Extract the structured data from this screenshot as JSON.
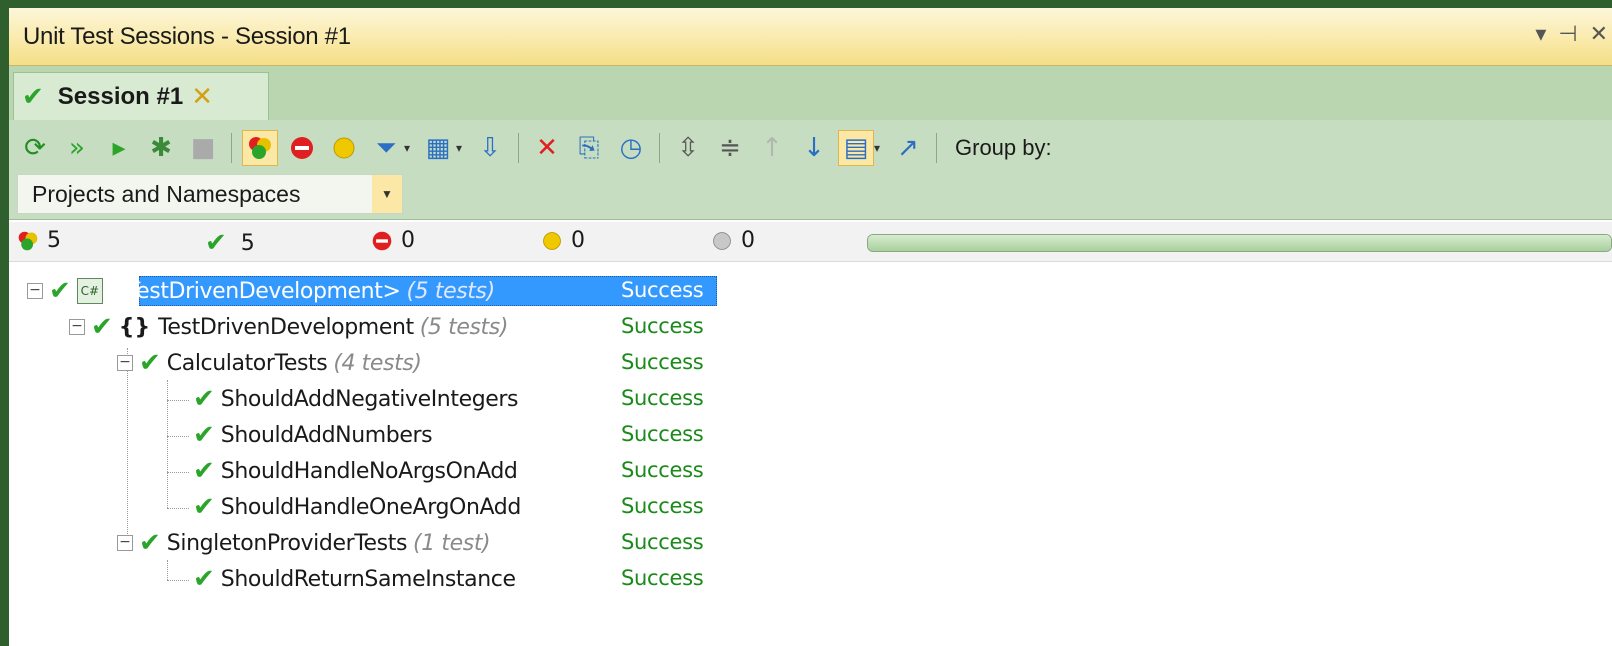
{
  "window": {
    "title": "Unit Test Sessions - Session #1",
    "controls": [
      "▾",
      "⊣",
      "✕"
    ]
  },
  "tab": {
    "label": "Session #1",
    "status_icon": "check-icon",
    "close_icon": "close-icon"
  },
  "toolbar": {
    "buttons": [
      "run-all-icon",
      "run-icon",
      "play-icon",
      "debug-icon",
      "stop-icon",
      "show-all-icon",
      "failed-icon",
      "ignored-icon",
      "filter-icon",
      "columns-icon",
      "auto-scroll-icon",
      "remove-icon",
      "export-icon",
      "history-icon",
      "expand-all-icon",
      "collapse-all-icon",
      "previous-icon",
      "next-icon",
      "layout-icon",
      "navigate-icon"
    ],
    "group_by_label": "Group by:",
    "group_by_value": "Projects and Namespaces"
  },
  "summary": {
    "total": "5",
    "passed": "5",
    "failed": "0",
    "ignored": "0",
    "unknown": "0",
    "progress_fraction": 1.0,
    "colors": {
      "passed": "#2aa52a",
      "failed": "#e02020",
      "ignored": "#e8c000",
      "unknown": "#9a9a9a"
    }
  },
  "tree": {
    "project": {
      "name": "<TestDrivenDevelopment>",
      "count": "(5 tests)",
      "status": "Success",
      "icon": "csharp-project-icon"
    },
    "namespace": {
      "name": "TestDrivenDevelopment",
      "count": "(5 tests)",
      "status": "Success",
      "icon": "namespace-icon"
    },
    "classes": [
      {
        "name": "CalculatorTests",
        "count": "(4 tests)",
        "status": "Success",
        "tests": [
          {
            "name": "ShouldAddNegativeIntegers",
            "status": "Success"
          },
          {
            "name": "ShouldAddNumbers",
            "status": "Success"
          },
          {
            "name": "ShouldHandleNoArgsOnAdd",
            "status": "Success"
          },
          {
            "name": "ShouldHandleOneArgOnAdd",
            "status": "Success"
          }
        ]
      },
      {
        "name": "SingletonProviderTests",
        "count": "(1 test)",
        "status": "Success",
        "tests": [
          {
            "name": "ShouldReturnSameInstance",
            "status": "Success"
          }
        ]
      }
    ]
  }
}
